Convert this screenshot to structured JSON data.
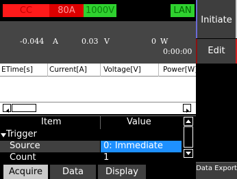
{
  "status": {
    "mode": "CC",
    "range_current": "80A",
    "range_voltage": "1000V",
    "interface": "LAN"
  },
  "measure": {
    "current": "-0.044",
    "current_unit": "A",
    "voltage": "0.03",
    "voltage_unit": "V",
    "power": "0",
    "power_unit": "W",
    "elapsed": "0:00:00"
  },
  "log_table": {
    "columns": [
      "ETime[s]",
      "Current[A]",
      "Voltage[V]",
      "Power[W]"
    ]
  },
  "settings_table": {
    "headers": {
      "item": "Item",
      "value": "Value"
    },
    "group": "Trigger",
    "rows": [
      {
        "item": "Source",
        "value": "0: Immediate"
      },
      {
        "item": "Count",
        "value": "1"
      }
    ]
  },
  "right_buttons": {
    "initiate": "Initiate",
    "edit": "Edit",
    "data_export": "Data Export"
  },
  "tabs": [
    "Acquire",
    "Data",
    "Display"
  ],
  "icons": {
    "scroll_left": "scroll-left-arrow",
    "scroll_right": "scroll-right-arrow",
    "scroll_up": "scroll-up-arrow",
    "scroll_down": "scroll-down-arrow",
    "expand": "collapse-triangle"
  },
  "colors": {
    "cc_bg": "#ff1a1a",
    "cc_text": "#c00000",
    "range_bg": "#dd0000",
    "range_text": "#ff9a9a",
    "volt_bg": "#2fd12f",
    "volt_text": "#0b7f0b",
    "lan_bg": "#2fd12f",
    "lan_text": "#006600",
    "selected": "#1e90ff"
  }
}
